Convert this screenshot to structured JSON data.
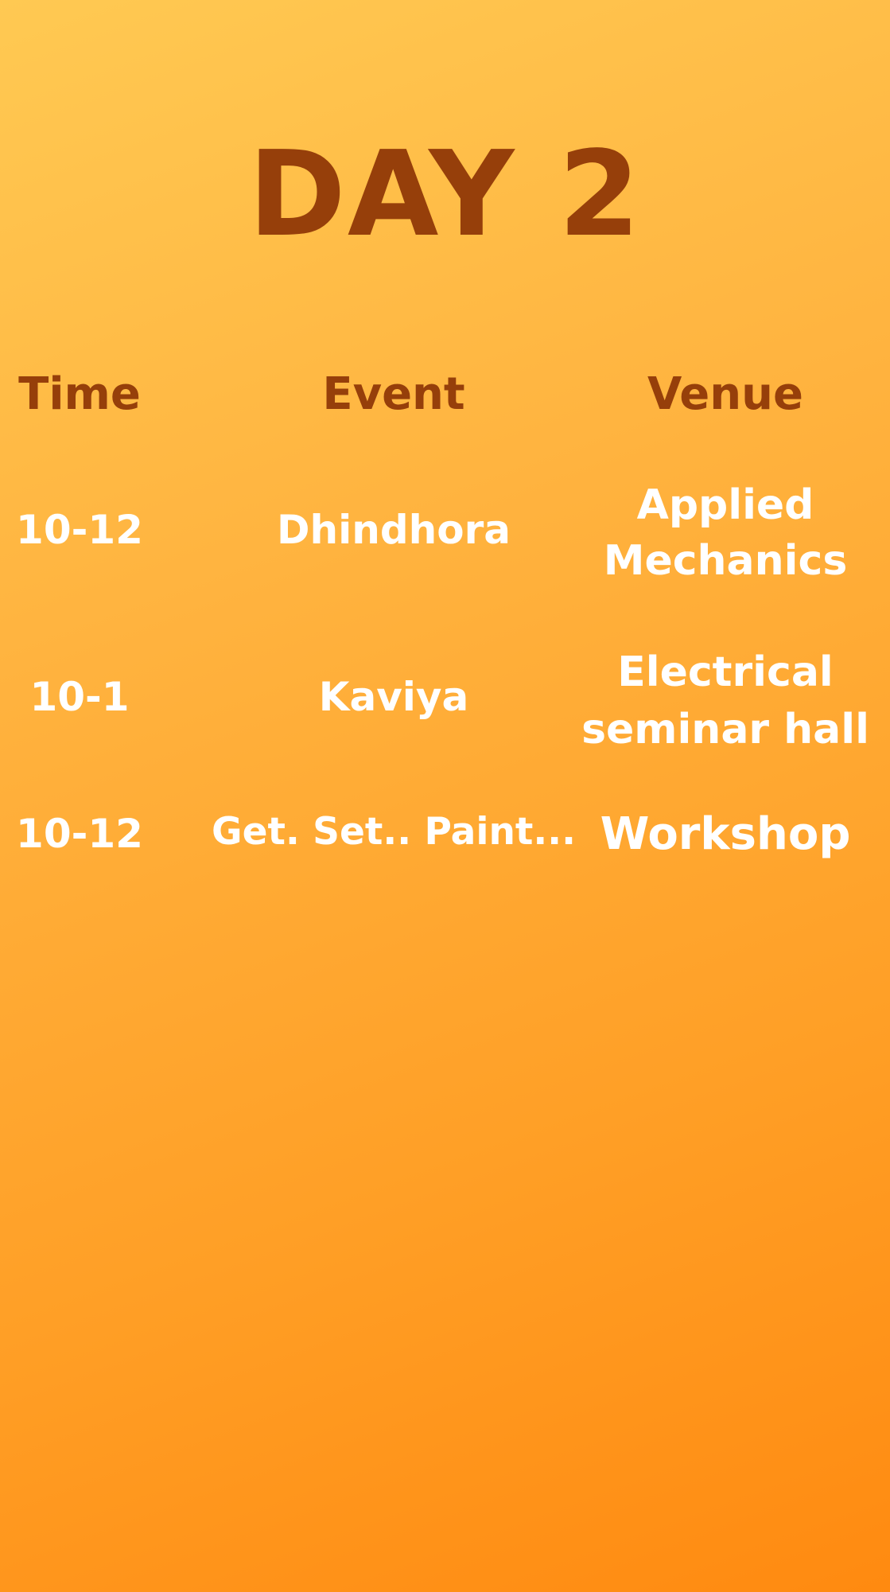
{
  "title": "DAY 2",
  "colors": {
    "title": "#963f0a",
    "headers": "#963f0a",
    "values": "#ffffff",
    "background_top": "#ffc952",
    "background_bottom": "#ff8a10"
  },
  "schedule": {
    "headers": {
      "time": "Time",
      "event": "Event",
      "venue": "Venue"
    },
    "rows": [
      {
        "time": "10-12",
        "event": "Dhindhora",
        "venue_line1": "Applied",
        "venue_line2": "Mechanics"
      },
      {
        "time": "10-1",
        "event": "Kaviya",
        "venue_line1": "Electrical",
        "venue_line2": "seminar hall"
      },
      {
        "time": "10-12",
        "event": "Get. Set.. Paint...",
        "venue_line1": "Workshop"
      }
    ]
  }
}
